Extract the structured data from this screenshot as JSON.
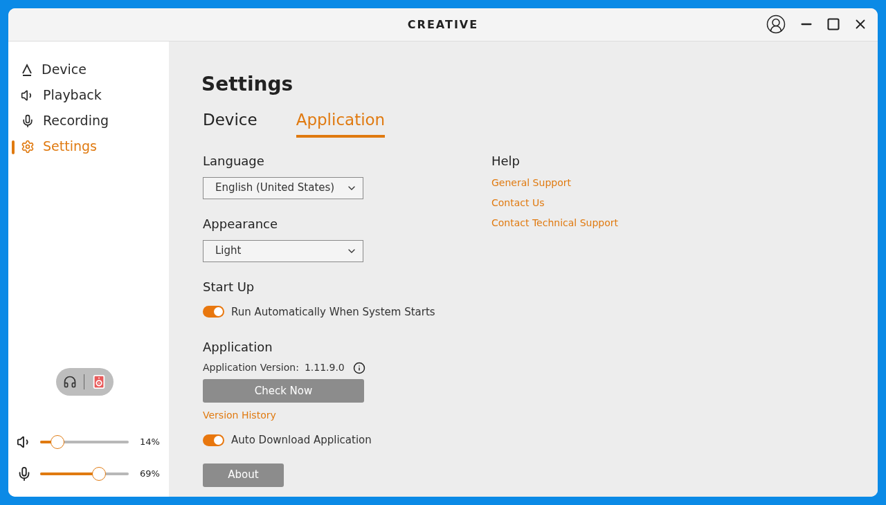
{
  "window": {
    "logo": "CREATIVE"
  },
  "sidebar": {
    "items": [
      {
        "kind": "device",
        "label": "Device",
        "selected": false
      },
      {
        "kind": "playback",
        "label": "Playback",
        "selected": false
      },
      {
        "kind": "recording",
        "label": "Recording",
        "selected": false
      },
      {
        "kind": "settings",
        "label": "Settings",
        "selected": true
      }
    ],
    "outputs": [
      {
        "kind": "headphones",
        "selected": false
      },
      {
        "kind": "speaker",
        "selected": true
      }
    ],
    "sliders": [
      {
        "kind": "speaker",
        "level": 0.14,
        "reading": "14%"
      },
      {
        "kind": "microphone",
        "level": 0.69,
        "reading": "69%"
      }
    ]
  },
  "title": "Settings",
  "tabs": [
    {
      "label": "Device",
      "selected": false
    },
    {
      "label": "Application",
      "selected": true
    }
  ],
  "language": {
    "label": "Language",
    "value": "English (United States)"
  },
  "appearance": {
    "label": "Appearance",
    "value": "Light"
  },
  "startup": {
    "label": "Start Up",
    "toggle": {
      "label": "Run Automatically When System Starts",
      "on": true
    }
  },
  "application": {
    "label": "Application",
    "version_label": "Application Version:",
    "version": "1.11.9.0",
    "check_button": "Check Now",
    "history_link": "Version History",
    "toggle": {
      "label": "Auto Download Application",
      "on": true
    },
    "about_button": "About"
  },
  "help": {
    "label": "Help",
    "links": [
      "General Support",
      "Contact Us",
      "Contact Technical Support"
    ]
  }
}
